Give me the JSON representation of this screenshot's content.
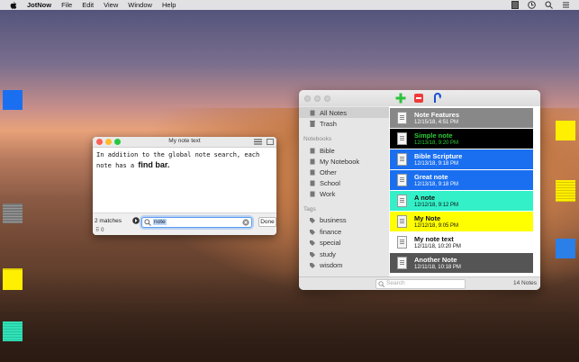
{
  "menubar": {
    "app_name": "JotNow",
    "items": [
      "File",
      "Edit",
      "View",
      "Window",
      "Help"
    ]
  },
  "note_window": {
    "title": "My note text",
    "body_text": "In addition to the global note search, each note has a",
    "body_bold": "find bar.",
    "find": {
      "matches": "2 matches",
      "query": "note",
      "done_label": "Done",
      "counter": "0"
    }
  },
  "main_window": {
    "sidebar": {
      "top_items": [
        {
          "label": "All Notes",
          "icon": "notes-icon"
        },
        {
          "label": "Trash",
          "icon": "trash-icon"
        }
      ],
      "notebooks_heading": "Notebooks",
      "notebooks": [
        "Bible",
        "My Notebook",
        "Other",
        "School",
        "Work"
      ],
      "tags_heading": "Tags",
      "tags": [
        "business",
        "finance",
        "special",
        "study",
        "wisdom"
      ]
    },
    "notes": [
      {
        "title": "Note Features",
        "date": "12/15/18, 4:51 PM",
        "bg": "#888888",
        "fg": "#ffffff"
      },
      {
        "title": "Simple note",
        "date": "12/13/18, 9:20 PM",
        "bg": "#000000",
        "fg": "#2ecf3a"
      },
      {
        "title": "Bible Scripture",
        "date": "12/13/18, 9:18 PM",
        "bg": "#1a6ff0",
        "fg": "#ffffff"
      },
      {
        "title": "Great note",
        "date": "12/13/18, 9:18 PM",
        "bg": "#1a6ff0",
        "fg": "#ffffff"
      },
      {
        "title": "A note",
        "date": "12/12/18, 9:12 PM",
        "bg": "#33f0c8",
        "fg": "#111111"
      },
      {
        "title": "My Note",
        "date": "12/12/18, 9:05 PM",
        "bg": "#ffff00",
        "fg": "#111111"
      },
      {
        "title": "My note text",
        "date": "12/11/18, 10:20 PM",
        "bg": "#ffffff",
        "fg": "#111111"
      },
      {
        "title": "Another Note",
        "date": "12/11/18, 10:18 PM",
        "bg": "#555555",
        "fg": "#ffffff"
      }
    ],
    "search_placeholder": "Search",
    "note_count": "14 Notes"
  }
}
